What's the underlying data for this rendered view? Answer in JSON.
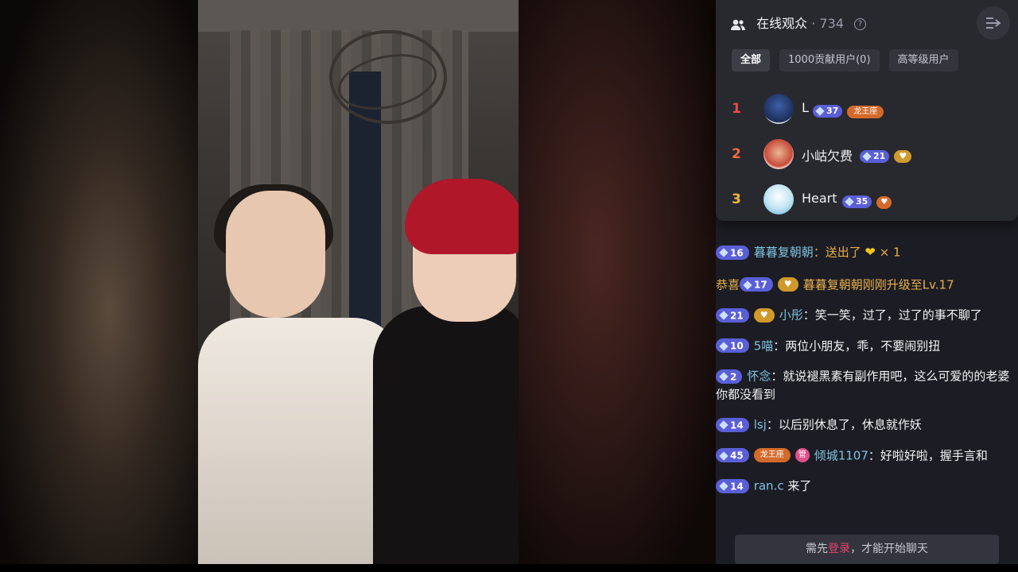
{
  "audience": {
    "title": "在线观众",
    "dot": "·",
    "count": "734",
    "help": "?",
    "tabs": [
      {
        "label": "全部"
      },
      {
        "label": "1000贡献用户(0)"
      },
      {
        "label": "高等级用户"
      }
    ],
    "ranking": [
      {
        "rank": "1",
        "name": "L",
        "level": "37",
        "badge": "龙王座",
        "color": "#e94a4a"
      },
      {
        "rank": "2",
        "name": "小岵欠费",
        "level": "21",
        "color": "#f06a3a"
      },
      {
        "rank": "3",
        "name": "Heart",
        "level": "35",
        "color": "#f0b93a"
      }
    ]
  },
  "chat": {
    "messages": [
      {
        "level": "16",
        "user": "暮暮复朝朝",
        "sep": "：",
        "text": "送出了",
        "extra": "× 1"
      },
      {
        "prefix": "恭喜",
        "level": "17",
        "text": "暮暮复朝朝刚刚升级至Lv.17"
      },
      {
        "level": "21",
        "user": "小彤",
        "sep": "：",
        "text": "笑一笑，过了，过了的事不聊了"
      },
      {
        "level": "10",
        "user": "5喵",
        "sep": "：",
        "text": "两位小朋友，乖，不要闹别扭"
      },
      {
        "level": "2",
        "user": "怀念",
        "sep": "：",
        "text": "就说褪黑素有副作用吧，这么可爱的的老婆你都没看到"
      },
      {
        "level": "14",
        "user": "lsj",
        "sep": "：",
        "text": "以后别休息了，休息就作妖"
      },
      {
        "level": "45",
        "badge": "龙王座",
        "pink": "管",
        "user": "倾城1107",
        "sep": "：",
        "text": "好啦好啦，握手言和"
      },
      {
        "level": "14",
        "user": "ran.c",
        "text": "来了"
      }
    ]
  },
  "input": {
    "before": "需先",
    "login": "登录",
    "after": "，才能开始聊天"
  },
  "colors": {
    "panel_bg": "#1c1c24",
    "popup_bg": "#28282f",
    "username": "#7ec2e0",
    "gold": "#e7b04a",
    "login_link": "#e8436b"
  }
}
